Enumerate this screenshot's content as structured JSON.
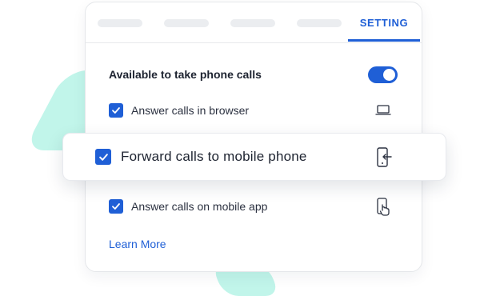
{
  "tabs": {
    "active_label": "SETTING"
  },
  "settings": {
    "available_title": "Available to take phone calls",
    "available_enabled": true,
    "items": [
      {
        "label": "Answer calls in browser",
        "checked": true,
        "icon": "laptop-icon"
      },
      {
        "label": "Forward calls to mobile phone",
        "checked": true,
        "icon": "phone-forward-icon"
      },
      {
        "label": "Answer calls on mobile app",
        "checked": true,
        "icon": "phone-tap-icon"
      }
    ],
    "learn_more": "Learn More"
  },
  "colors": {
    "accent": "#1f5fd6",
    "decor": "#b6f3e6",
    "text": "#1d2330"
  }
}
